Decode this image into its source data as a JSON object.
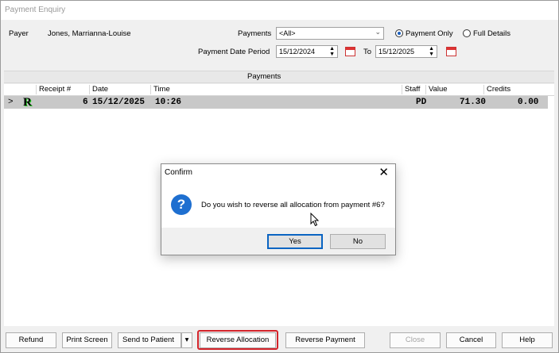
{
  "window": {
    "title": "Payment Enquiry"
  },
  "filters": {
    "payer_label": "Payer",
    "payer_name": "Jones, Marrianna-Louise",
    "payments_label": "Payments",
    "payments_value": "<All>",
    "radio_payment_only": "Payment Only",
    "radio_full_details": "Full Details",
    "selected_radio": "Payment Only",
    "date_period_label": "Payment Date Period",
    "date_from": "15/12/2024",
    "to_label": "To",
    "date_to": "15/12/2025"
  },
  "grid": {
    "section_title": "Payments",
    "columns": [
      "Receipt #",
      "Date",
      "Time",
      "Staff",
      "Value",
      "Credits"
    ],
    "rows": [
      {
        "expander": ">",
        "icon": "R",
        "receipt": "6",
        "date": "15/12/2025",
        "time": "10:26",
        "staff": "PD",
        "value": "71.30",
        "credits": "0.00"
      }
    ]
  },
  "buttons": {
    "refund": "Refund",
    "print_screen": "Print Screen",
    "send_to_patient": "Send to Patient",
    "reverse_allocation": "Reverse Allocation",
    "reverse_payment": "Reverse Payment",
    "close": "Close",
    "cancel": "Cancel",
    "help": "Help"
  },
  "dialog": {
    "title": "Confirm",
    "message": "Do you wish to reverse all allocation from payment #6?",
    "yes": "Yes",
    "no": "No",
    "close_glyph": "✕",
    "icon": "question-icon"
  },
  "colors": {
    "highlight": "#d3232a",
    "selected_row": "#c8c8c8",
    "accent": "#1e6fd0"
  }
}
